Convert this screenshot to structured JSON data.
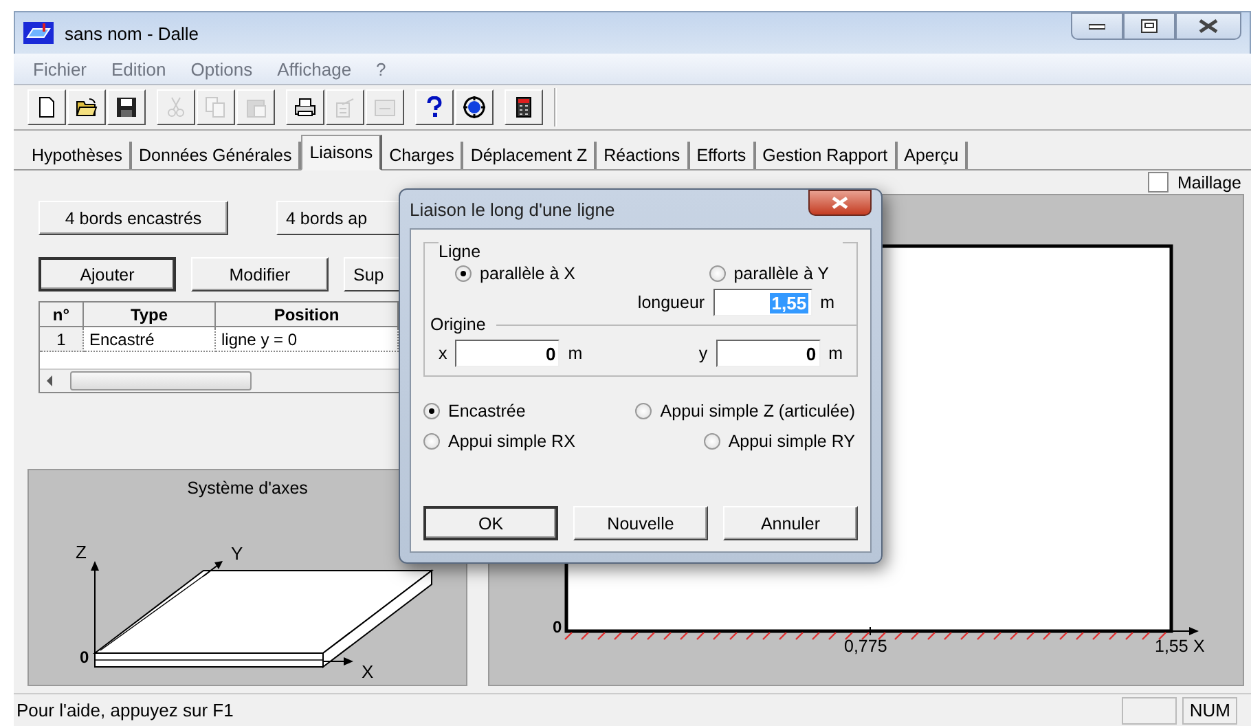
{
  "window": {
    "title": "sans nom - Dalle"
  },
  "menu": [
    "Fichier",
    "Edition",
    "Options",
    "Affichage",
    "?"
  ],
  "toolbar": [
    [
      {
        "kind": "new",
        "disabled": false
      },
      {
        "kind": "open",
        "disabled": false
      },
      {
        "kind": "save",
        "disabled": false
      }
    ],
    [
      {
        "kind": "cut",
        "disabled": true
      },
      {
        "kind": "copy",
        "disabled": true
      },
      {
        "kind": "paste",
        "disabled": true
      }
    ],
    [
      {
        "kind": "print",
        "disabled": false
      },
      {
        "kind": "properties",
        "disabled": true
      },
      {
        "kind": "tray",
        "disabled": true
      }
    ],
    [
      {
        "kind": "help",
        "disabled": false
      },
      {
        "kind": "target",
        "disabled": false
      }
    ],
    [
      {
        "kind": "calculator",
        "disabled": false
      }
    ]
  ],
  "tabs": [
    {
      "label": "Hypothèses",
      "selected": false
    },
    {
      "label": "Données Générales",
      "selected": false
    },
    {
      "label": "Liaisons",
      "selected": true
    },
    {
      "label": "Charges",
      "selected": false
    },
    {
      "label": "Déplacement Z",
      "selected": false
    },
    {
      "label": "Réactions",
      "selected": false
    },
    {
      "label": "Efforts",
      "selected": false
    },
    {
      "label": "Gestion Rapport",
      "selected": false
    },
    {
      "label": "Aperçu",
      "selected": false
    }
  ],
  "maillage": {
    "label": "Maillage",
    "checked": false
  },
  "preset_buttons": [
    "4 bords encastrés",
    "4 bords ap"
  ],
  "actions": [
    "Ajouter",
    "Modifier",
    "Sup"
  ],
  "table": {
    "columns": [
      "n°",
      "Type",
      "Position"
    ],
    "rows": [
      [
        "1",
        "Encastré",
        "ligne y = 0"
      ]
    ]
  },
  "axes_panel": {
    "title": "Système d'axes",
    "z": "Z",
    "y": "Y",
    "x": "X",
    "origin": "0"
  },
  "canvas": {
    "origin": "0",
    "ticks": [
      "0,775",
      "1,55"
    ],
    "axis": "X"
  },
  "dialog": {
    "title": "Liaison le long d'une ligne",
    "ligne": {
      "label": "Ligne",
      "options": [
        {
          "label": "parallèle à X",
          "selected": true
        },
        {
          "label": "parallèle à Y",
          "selected": false
        }
      ],
      "longueur": {
        "label": "longueur",
        "value": "1,55",
        "unit": "m",
        "text_selected": true
      }
    },
    "origine": {
      "label": "Origine",
      "fields": [
        {
          "label": "x",
          "value": "0",
          "unit": "m"
        },
        {
          "label": "y",
          "value": "0",
          "unit": "m"
        }
      ]
    },
    "support_options": [
      [
        {
          "label": "Encastrée",
          "selected": true
        },
        {
          "label": "Appui simple Z (articulée)",
          "selected": false
        }
      ],
      [
        {
          "label": "Appui simple RX",
          "selected": false
        },
        {
          "label": "Appui simple RY",
          "selected": false
        }
      ]
    ],
    "buttons": [
      {
        "label": "OK",
        "default": true
      },
      {
        "label": "Nouvelle",
        "default": false
      },
      {
        "label": "Annuler",
        "default": false
      }
    ]
  },
  "status_bar": {
    "text": "Pour l'aide, appuyez sur F1",
    "indicator": "NUM"
  }
}
